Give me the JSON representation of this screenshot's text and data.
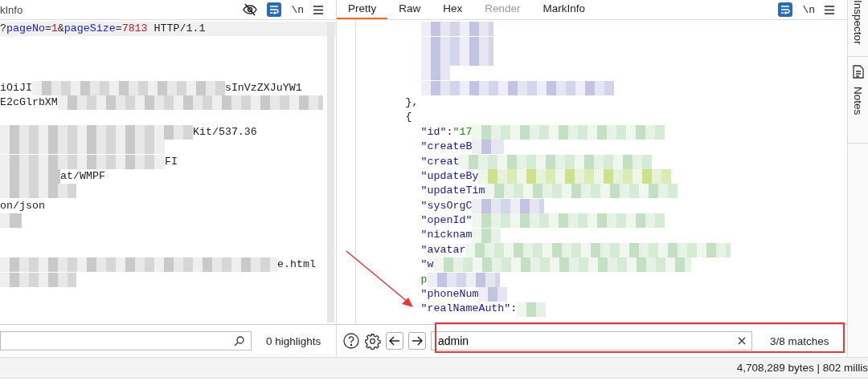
{
  "request_panel": {
    "tab_fragment": "kInfo",
    "toolbar": {
      "hidden_toggle": true,
      "wrap_on": true,
      "newline_label": "\\n"
    },
    "lines": [
      {
        "current": true,
        "segments": [
          {
            "kind": "plain",
            "text": "?"
          },
          {
            "kind": "param",
            "text": "pageNo"
          },
          {
            "kind": "plain",
            "text": "="
          },
          {
            "kind": "number",
            "text": "1"
          },
          {
            "kind": "plain",
            "text": "&"
          },
          {
            "kind": "param",
            "text": "pageSize"
          },
          {
            "kind": "plain",
            "text": "="
          },
          {
            "kind": "number",
            "text": "7813"
          },
          {
            "kind": "plain",
            "text": " HTTP/1.1"
          }
        ]
      },
      {
        "current": false
      },
      {
        "current": false
      },
      {
        "current": false
      },
      {
        "current": false,
        "segments": [
          {
            "kind": "plain",
            "text": "iOiJI"
          },
          {
            "kind": "blur"
          },
          {
            "kind": "plain",
            "text": "sInVzZXJuYW1"
          }
        ]
      },
      {
        "current": false,
        "segments": [
          {
            "kind": "plain",
            "text": "E2cGlrbXM"
          },
          {
            "kind": "blur"
          }
        ]
      },
      {
        "current": false
      },
      {
        "current": false,
        "segments": [
          {
            "kind": "blur"
          },
          {
            "kind": "plain",
            "text": "Kit/537.36"
          }
        ]
      },
      {
        "current": false,
        "segments": [
          {
            "kind": "blur"
          }
        ]
      },
      {
        "current": false,
        "segments": [
          {
            "kind": "blur"
          },
          {
            "kind": "plain",
            "text": "FI"
          }
        ]
      },
      {
        "current": false,
        "segments": [
          {
            "kind": "blur"
          },
          {
            "kind": "plain",
            "text": "at/WMPF"
          }
        ]
      },
      {
        "current": false,
        "segments": [
          {
            "kind": "blur"
          }
        ]
      },
      {
        "current": false,
        "segments": [
          {
            "kind": "plain",
            "text": "on/json"
          }
        ]
      },
      {
        "current": false,
        "segments": [
          {
            "kind": "blur"
          }
        ]
      },
      {
        "current": false
      },
      {
        "current": false
      },
      {
        "current": false,
        "segments": [
          {
            "kind": "blur"
          },
          {
            "kind": "plain",
            "text": "e.html"
          }
        ]
      },
      {
        "current": false,
        "segments": [
          {
            "kind": "blur"
          }
        ]
      }
    ],
    "search": {
      "highlights": "0 highlights"
    }
  },
  "response_panel": {
    "tabs": [
      {
        "label": "Pretty",
        "selected": true,
        "disabled": false
      },
      {
        "label": "Raw",
        "selected": false,
        "disabled": false
      },
      {
        "label": "Hex",
        "selected": false,
        "disabled": false
      },
      {
        "label": "Render",
        "selected": false,
        "disabled": true
      },
      {
        "label": "MarkInfo",
        "selected": false,
        "disabled": false
      }
    ],
    "toolbar": {
      "wrap_on": true,
      "newline_label": "\\n"
    },
    "lines": [
      {
        "kind": "member",
        "segments": [
          {
            "kind": "blur"
          }
        ]
      },
      {
        "kind": "member",
        "segments": [
          {
            "kind": "blur"
          }
        ]
      },
      {
        "kind": "member",
        "segments": [
          {
            "kind": "blur"
          }
        ]
      },
      {
        "kind": "member",
        "segments": [
          {
            "kind": "blur"
          }
        ]
      },
      {
        "kind": "member",
        "segments": [
          {
            "kind": "blur"
          }
        ]
      },
      {
        "kind": "brace",
        "segments": [
          {
            "kind": "plain",
            "text": "},"
          }
        ]
      },
      {
        "kind": "brace",
        "segments": [
          {
            "kind": "plain",
            "text": "{"
          }
        ]
      },
      {
        "kind": "member",
        "segments": [
          {
            "kind": "key",
            "text": "\"id\""
          },
          {
            "kind": "plain",
            "text": ":"
          },
          {
            "kind": "string",
            "text": "\"17"
          },
          {
            "kind": "blur"
          }
        ]
      },
      {
        "kind": "member",
        "segments": [
          {
            "kind": "key",
            "text": "\"createB"
          },
          {
            "kind": "blur"
          }
        ]
      },
      {
        "kind": "member",
        "segments": [
          {
            "kind": "key",
            "text": "\"creat"
          },
          {
            "kind": "blur"
          }
        ]
      },
      {
        "kind": "member",
        "segments": [
          {
            "kind": "key",
            "text": "\"updateBy"
          },
          {
            "kind": "blur"
          }
        ]
      },
      {
        "kind": "member",
        "segments": [
          {
            "kind": "key",
            "text": "\"updateTim"
          },
          {
            "kind": "blur"
          }
        ]
      },
      {
        "kind": "member",
        "segments": [
          {
            "kind": "key",
            "text": "\"sysOrgC"
          },
          {
            "kind": "blur"
          }
        ]
      },
      {
        "kind": "member",
        "segments": [
          {
            "kind": "key",
            "text": "\"openId\""
          },
          {
            "kind": "blur"
          }
        ]
      },
      {
        "kind": "member",
        "segments": [
          {
            "kind": "key",
            "text": "\"nicknam"
          },
          {
            "kind": "blur"
          }
        ]
      },
      {
        "kind": "member",
        "segments": [
          {
            "kind": "key",
            "text": "\"avatar"
          },
          {
            "kind": "blur"
          }
        ]
      },
      {
        "kind": "member",
        "segments": [
          {
            "kind": "key",
            "text": "\"w"
          },
          {
            "kind": "blur"
          }
        ]
      },
      {
        "kind": "member",
        "segments": [
          {
            "kind": "string",
            "text": "p"
          },
          {
            "kind": "blur"
          }
        ]
      },
      {
        "kind": "member",
        "segments": [
          {
            "kind": "key",
            "text": "\"phoneNum"
          },
          {
            "kind": "blur"
          }
        ]
      },
      {
        "kind": "member",
        "segments": [
          {
            "kind": "key",
            "text": "\"realNameAuth\""
          },
          {
            "kind": "plain",
            "text": ":"
          },
          {
            "kind": "blur"
          }
        ]
      }
    ],
    "search": {
      "value": "admin",
      "matches": "3/8 matches"
    }
  },
  "side_tabs": [
    {
      "label": "Inspector",
      "kind": "text"
    },
    {
      "label": "Notes",
      "kind": "notes"
    }
  ],
  "status_bar": {
    "text": "4,708,289 bytes | 802 millis"
  },
  "annotations": {
    "highlight_frame": true,
    "arrow": true
  }
}
